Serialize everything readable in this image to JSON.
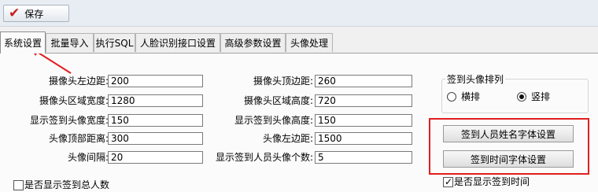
{
  "toolbar": {
    "save_label": "保存"
  },
  "tabs": [
    "系统设置",
    "批量导入",
    "执行SQL",
    "人脸识别接口设置",
    "高级参数设置",
    "头像处理"
  ],
  "fields": {
    "left": [
      {
        "label": "摄像头左边距:",
        "value": "200"
      },
      {
        "label": "摄像头区域宽度:",
        "value": "1280"
      },
      {
        "label": "显示签到头像宽度:",
        "value": "150"
      },
      {
        "label": "头像顶部距离:",
        "value": "300"
      },
      {
        "label": "头像间隔:",
        "value": "20"
      }
    ],
    "right": [
      {
        "label": "摄像头顶边距:",
        "value": "260"
      },
      {
        "label": "摄像头区域高度:",
        "value": "720"
      },
      {
        "label": "显示签到头像高度:",
        "value": "150"
      },
      {
        "label": "头像左边距:",
        "value": "1500"
      },
      {
        "label": "显示签到人员头像个数:",
        "value": "5"
      }
    ]
  },
  "sort": {
    "title": "签到头像排列",
    "horizontal": "横排",
    "vertical": "竖排",
    "selected": "竖排"
  },
  "buttons": {
    "name_font": "签到人员姓名字体设置",
    "time_font": "签到时间字体设置"
  },
  "checkboxes": {
    "show_total": {
      "label": "是否显示签到总人数",
      "checked": false
    },
    "show_time": {
      "label": "是否显示签到时间",
      "checked": true
    }
  },
  "colors": {
    "highlight": "#e11f1f",
    "save_check": "#c81e1e"
  }
}
